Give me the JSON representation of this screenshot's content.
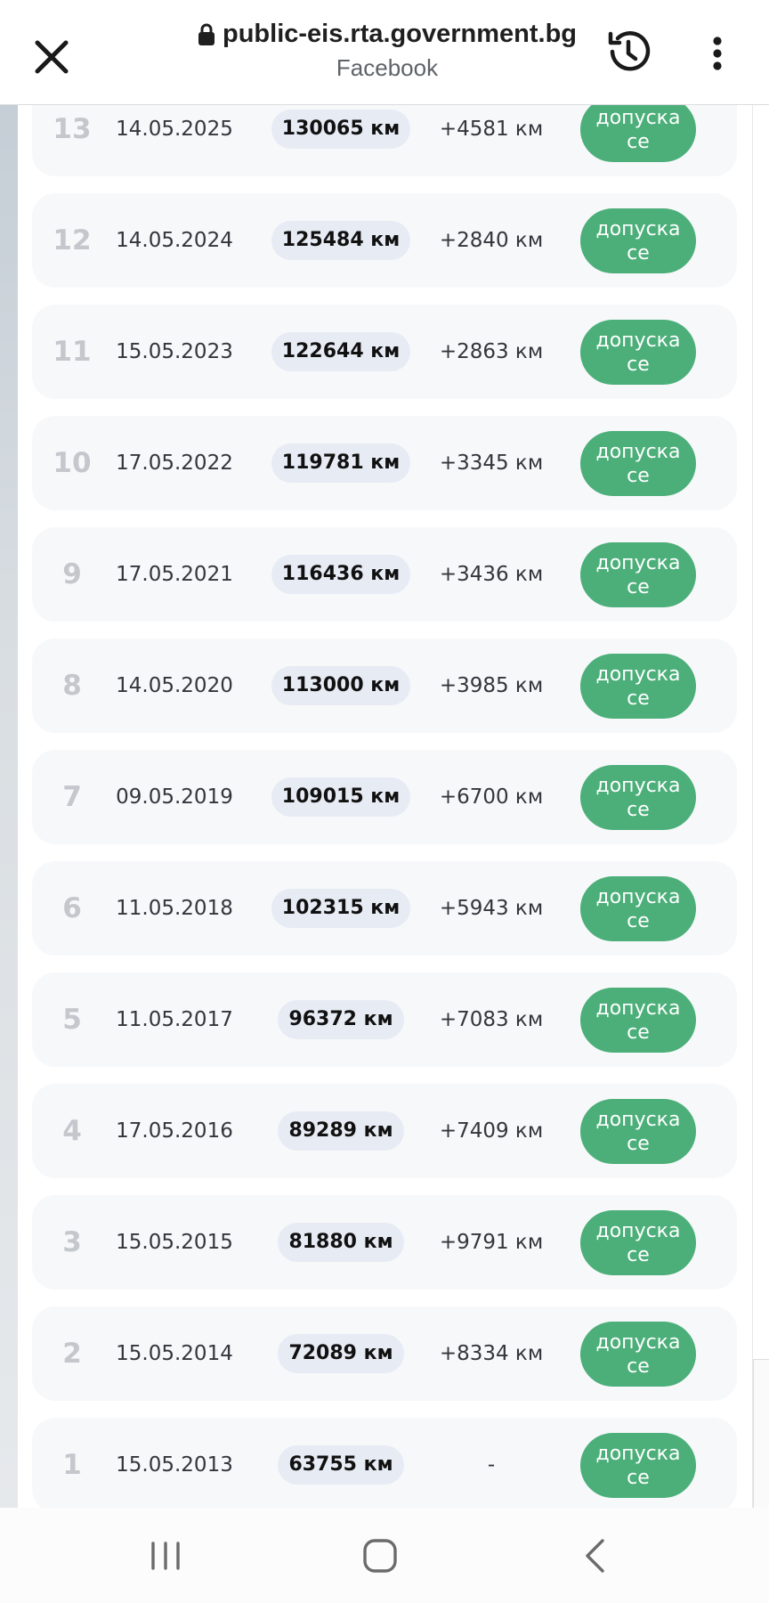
{
  "browser": {
    "url": "public-eis.rta.government.bg",
    "subtitle": "Facebook"
  },
  "icons": {
    "close": "close-icon",
    "lock": "lock-icon",
    "history": "history-icon",
    "menu": "more-vert-icon",
    "recents": "recents-icon",
    "home": "home-icon",
    "back": "back-icon"
  },
  "colors": {
    "status_green": "#4caf7a",
    "km_pill": "#e7ebf4",
    "row_bg": "#f7f8fa"
  },
  "inspections": [
    {
      "num": "13",
      "date": "14.05.2025",
      "km": "130065 км",
      "diff": "+4581 км",
      "status": "допуска\nсе"
    },
    {
      "num": "12",
      "date": "14.05.2024",
      "km": "125484 км",
      "diff": "+2840 км",
      "status": "допуска\nсе"
    },
    {
      "num": "11",
      "date": "15.05.2023",
      "km": "122644 км",
      "diff": "+2863 км",
      "status": "допуска\nсе"
    },
    {
      "num": "10",
      "date": "17.05.2022",
      "km": "119781 км",
      "diff": "+3345 км",
      "status": "допуска\nсе"
    },
    {
      "num": "9",
      "date": "17.05.2021",
      "km": "116436 км",
      "diff": "+3436 км",
      "status": "допуска\nсе"
    },
    {
      "num": "8",
      "date": "14.05.2020",
      "km": "113000 км",
      "diff": "+3985 км",
      "status": "допуска\nсе"
    },
    {
      "num": "7",
      "date": "09.05.2019",
      "km": "109015 км",
      "diff": "+6700 км",
      "status": "допуска\nсе"
    },
    {
      "num": "6",
      "date": "11.05.2018",
      "km": "102315 км",
      "diff": "+5943 км",
      "status": "допуска\nсе"
    },
    {
      "num": "5",
      "date": "11.05.2017",
      "km": "96372 км",
      "diff": "+7083 км",
      "status": "допуска\nсе"
    },
    {
      "num": "4",
      "date": "17.05.2016",
      "km": "89289 км",
      "diff": "+7409 км",
      "status": "допуска\nсе"
    },
    {
      "num": "3",
      "date": "15.05.2015",
      "km": "81880 км",
      "diff": "+9791 км",
      "status": "допуска\nсе"
    },
    {
      "num": "2",
      "date": "15.05.2014",
      "km": "72089 км",
      "diff": "+8334 км",
      "status": "допуска\nсе"
    },
    {
      "num": "1",
      "date": "15.05.2013",
      "km": "63755 км",
      "diff": "-",
      "status": "допуска\nсе"
    }
  ]
}
